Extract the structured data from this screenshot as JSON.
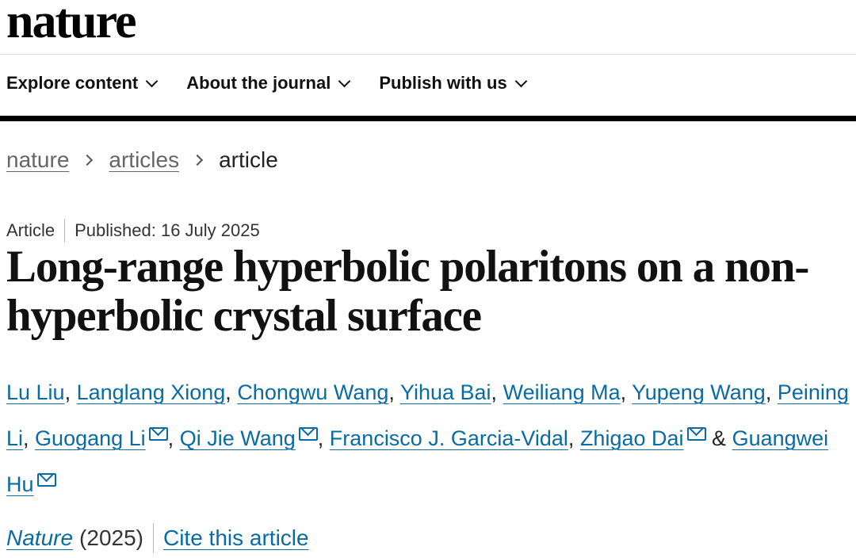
{
  "site": {
    "logo": "nature"
  },
  "nav": {
    "items": [
      {
        "label": "Explore content"
      },
      {
        "label": "About the journal"
      },
      {
        "label": "Publish with us"
      }
    ]
  },
  "breadcrumb": {
    "items": [
      "nature",
      "articles",
      "article"
    ]
  },
  "article": {
    "type": "Article",
    "published": "Published: 16 July 2025",
    "title": "Long-range hyperbolic polaritons on a non-hyperbolic crystal surface",
    "authors": [
      {
        "name": "Lu Liu",
        "corresponding": false
      },
      {
        "name": "Langlang Xiong",
        "corresponding": false
      },
      {
        "name": "Chongwu Wang",
        "corresponding": false
      },
      {
        "name": "Yihua Bai",
        "corresponding": false
      },
      {
        "name": "Weiliang Ma",
        "corresponding": false
      },
      {
        "name": "Yupeng Wang",
        "corresponding": false
      },
      {
        "name": "Peining Li",
        "corresponding": false
      },
      {
        "name": "Guogang Li",
        "corresponding": true
      },
      {
        "name": "Qi Jie Wang",
        "corresponding": true
      },
      {
        "name": "Francisco J. Garcia-Vidal",
        "corresponding": false
      },
      {
        "name": "Zhigao Dai",
        "corresponding": true
      },
      {
        "name": "Guangwei Hu",
        "corresponding": true
      }
    ],
    "author_separator": ",",
    "author_final_joiner": "&",
    "journal": "Nature",
    "year": "(2025)",
    "cite_label": "Cite this article"
  },
  "colors": {
    "link": "#0a6ba3",
    "text": "#222222",
    "rule": "#000000"
  },
  "icons": {
    "nav_dropdown": "chevron-down-icon",
    "breadcrumb_separator": "chevron-right-icon",
    "corresponding_author": "mail-icon"
  }
}
